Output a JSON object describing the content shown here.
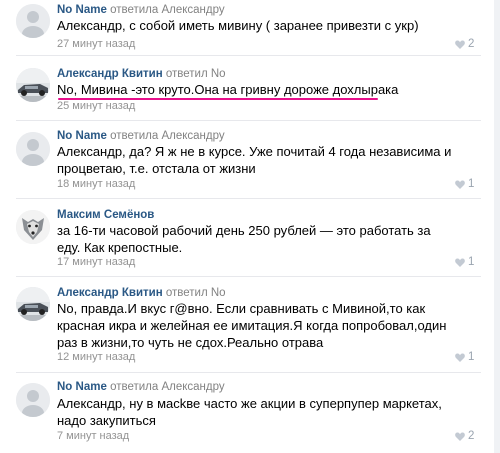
{
  "comments": [
    {
      "author": "No Name",
      "reply": "ответила Александру",
      "text": "Александр, с собой иметь мивину ( заранее привезти с укр)",
      "time": "27 минут назад",
      "likes": "2",
      "avatar": "default"
    },
    {
      "author": "Александр Квитин",
      "reply": "ответил No",
      "text": "No, Мивина -это круто.Она на гривну дороже дохлырака",
      "time": "25 минут назад",
      "likes": "",
      "avatar": "car"
    },
    {
      "author": "No Name",
      "reply": "ответила Александру",
      "text": "Александр, да? Я ж не в курсе. Уже почитай 4 года независима и процветаю, т.е. отстала от жизни",
      "time": "18 минут назад",
      "likes": "1",
      "avatar": "default"
    },
    {
      "author": "Максим Семёнов",
      "reply": "",
      "text": "за 16-ти часовой рабочий день 250 рублей — это работать за еду. Как крепостные.",
      "time": "17 минут назад",
      "likes": "1",
      "avatar": "dog"
    },
    {
      "author": "Александр Квитин",
      "reply": "ответил No",
      "text": "No, правда.И вкус г@вно. Если сравнивать с Мивиной,то как красная икра и желейная ее имитация.Я когда попробовал,один раз в жизни,то чуть не сдох.Реально отрава",
      "time": "12 минут назад",
      "likes": "1",
      "avatar": "car"
    },
    {
      "author": "No Name",
      "reply": "ответила Александру",
      "text": "Александр, ну в масkве часто же акции в суперпупер маркетах, надо закупиться",
      "time": "7 минут назад",
      "likes": "2",
      "avatar": "default"
    }
  ],
  "colors": {
    "author": "#2a5885",
    "meta": "#939393",
    "like": "#c3cad3",
    "highlight": "#e8108c"
  },
  "icons": {
    "like": "heart-icon"
  }
}
